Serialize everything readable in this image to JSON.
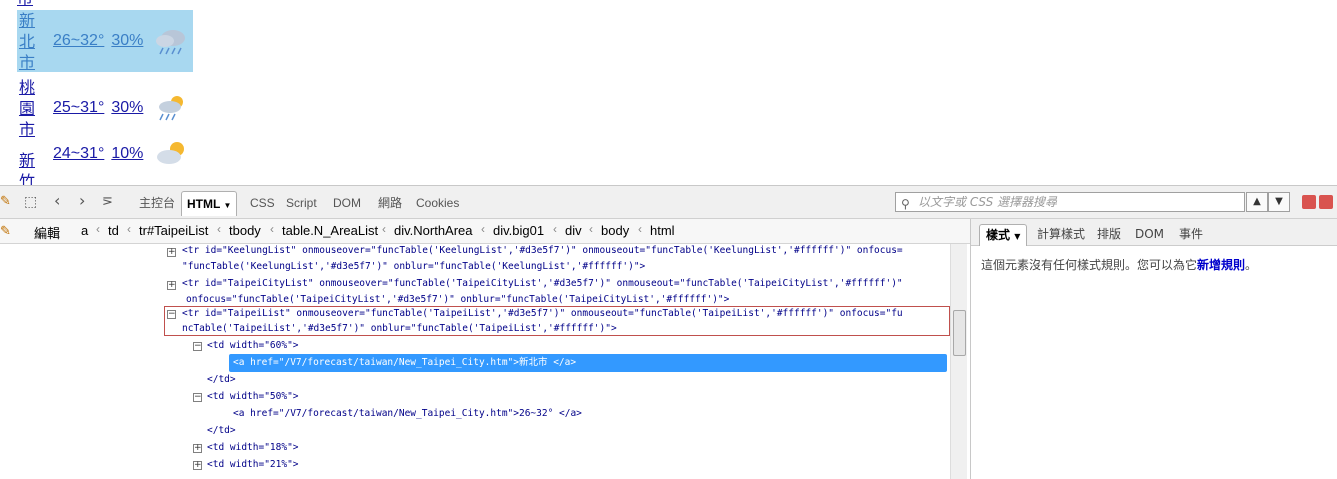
{
  "weather": {
    "rows": [
      {
        "city": "新北市",
        "chars": [
          "新",
          "北",
          "市"
        ],
        "temp": "26~32°",
        "rain": "30%",
        "icon": "cloud-rain-icon",
        "highlighted": true
      },
      {
        "city": "桃園市",
        "chars": [
          "桃",
          "園",
          "市"
        ],
        "temp": "25~31°",
        "rain": "30%",
        "icon": "sun-cloud-rain-icon",
        "highlighted": false
      },
      {
        "city": "新竹",
        "chars": [
          "新",
          "竹"
        ],
        "temp": "24~31°",
        "rain": "10%",
        "icon": "sun-cloud-icon",
        "highlighted": false
      }
    ]
  },
  "firebug": {
    "tabs": [
      "主控台",
      "HTML",
      "CSS",
      "Script",
      "DOM",
      "網路",
      "Cookies"
    ],
    "active_tab": "HTML",
    "search_placeholder": "以文字或 CSS 選擇器搜尋",
    "edit_label": "編輯",
    "breadcrumb": [
      "a",
      "td",
      "tr#TaipeiList",
      "tbody",
      "table.N_AreaList",
      "div.NorthArea",
      "div.big01",
      "div",
      "body",
      "html"
    ],
    "side_tabs": [
      "樣式",
      "計算樣式",
      "排版",
      "DOM",
      "事件"
    ],
    "side_message": "這個元素沒有任何樣式規則。您可以為它",
    "side_link": "新增規則",
    "side_message_end": "。"
  },
  "tree": {
    "lines": [
      "<tr id=\"KeelungList\" onmouseover=\"funcTable('KeelungList','#d3e5f7')\" onmouseout=\"funcTable('KeelungList','#ffffff')\" onfocus=",
      "\"funcTable('KeelungList','#d3e5f7')\" onblur=\"funcTable('KeelungList','#ffffff')\">",
      "<tr id=\"TaipeiCityList\" onmouseover=\"funcTable('TaipeiCityList','#d3e5f7')\" onmouseout=\"funcTable('TaipeiCityList','#ffffff')\"",
      "onfocus=\"funcTable('TaipeiCityList','#d3e5f7')\" onblur=\"funcTable('TaipeiCityList','#ffffff')\">",
      "<tr id=\"TaipeiList\" onmouseover=\"funcTable('TaipeiList','#d3e5f7')\" onmouseout=\"funcTable('TaipeiList','#ffffff')\" onfocus=\"fu",
      "ncTable('TaipeiList','#d3e5f7')\" onblur=\"funcTable('TaipeiList','#ffffff')\">",
      "<td width=\"60%\">",
      "<a href=\"/V7/forecast/taiwan/New_Taipei_City.htm\">新北市 </a>",
      "</td>",
      "<td width=\"50%\">",
      "<a href=\"/V7/forecast/taiwan/New_Taipei_City.htm\">26~32° </a>",
      "</td>",
      "<td width=\"18%\">",
      "<td width=\"21%\">"
    ]
  },
  "colors": {
    "highlight_row": "#a8d8f0",
    "selected_node": "#3399ff",
    "selection_box": "#c0504d"
  }
}
